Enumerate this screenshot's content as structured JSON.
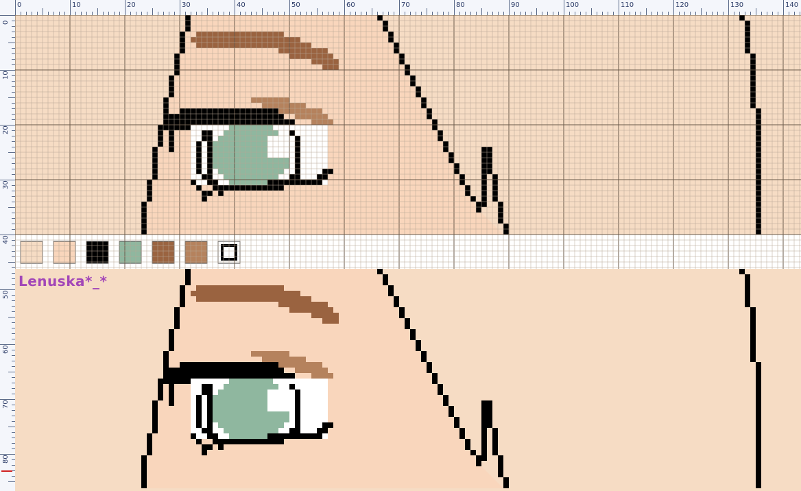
{
  "ruler_top_labels": [
    "0",
    "10",
    "20",
    "30",
    "40",
    "50",
    "60",
    "70",
    "80",
    "90",
    "100",
    "110",
    "120",
    "130",
    "140"
  ],
  "ruler_left_labels": [
    "0",
    "10",
    "20",
    "30",
    "40",
    "50",
    "60",
    "70",
    "80"
  ],
  "watermark": "Lenuska*_*",
  "colors": {
    "skin_light": "#f6dcc4",
    "skin_pink": "#f9d6bc",
    "black": "#000000",
    "iris_green": "#8fb79f",
    "brow_dark": "#9a6340",
    "brow_light": "#b5825d",
    "white": "#ffffff",
    "grid_line": "#b6a695",
    "ruler_bg": "#f4f6fb"
  },
  "palette": [
    {
      "name": "skin-light",
      "color": "#f6dcc4"
    },
    {
      "name": "skin-pink",
      "color": "#f9d6bc"
    },
    {
      "name": "black",
      "color": "#000000"
    },
    {
      "name": "iris-green",
      "color": "#8fb79f"
    },
    {
      "name": "brow-dark",
      "color": "#9a6340"
    },
    {
      "name": "brow-light",
      "color": "#b5825d"
    },
    {
      "name": "outline-swatch",
      "color": "#ffffff"
    }
  ]
}
